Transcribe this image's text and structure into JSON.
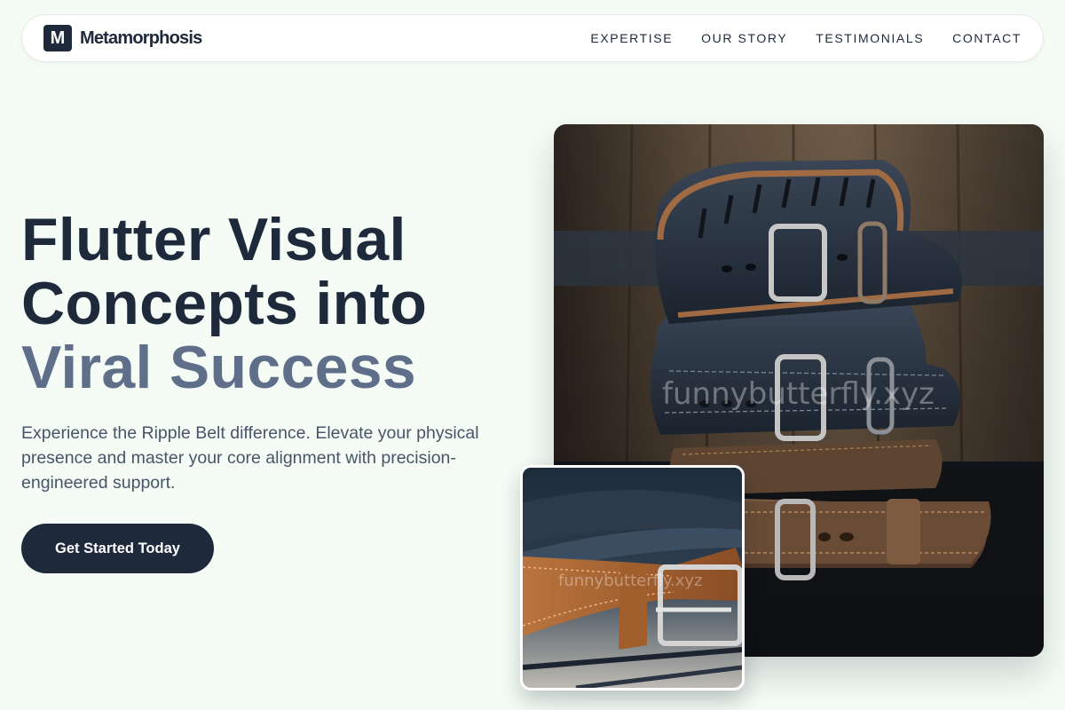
{
  "brand": {
    "mark": "M",
    "name": "Metamorphosis"
  },
  "nav": {
    "links": [
      "EXPERTISE",
      "OUR STORY",
      "TESTIMONIALS",
      "CONTACT"
    ]
  },
  "hero": {
    "title_line_1": "Flutter Visual",
    "title_line_2": "Concepts into",
    "title_line_3": "Viral Success",
    "subtitle": "Experience the Ripple Belt difference. Elevate your physical presence and master your core alignment with precision-engineered support.",
    "cta_label": "Get Started Today"
  },
  "images": {
    "main_watermark": "funnybutterfly.xyz",
    "inset_watermark": "funnybutterfly.xyz"
  },
  "colors": {
    "page_background": "#f4fcf5",
    "primary_dark": "#1e293b",
    "accent_slate": "#5f6f8a",
    "body_text": "#475569"
  }
}
